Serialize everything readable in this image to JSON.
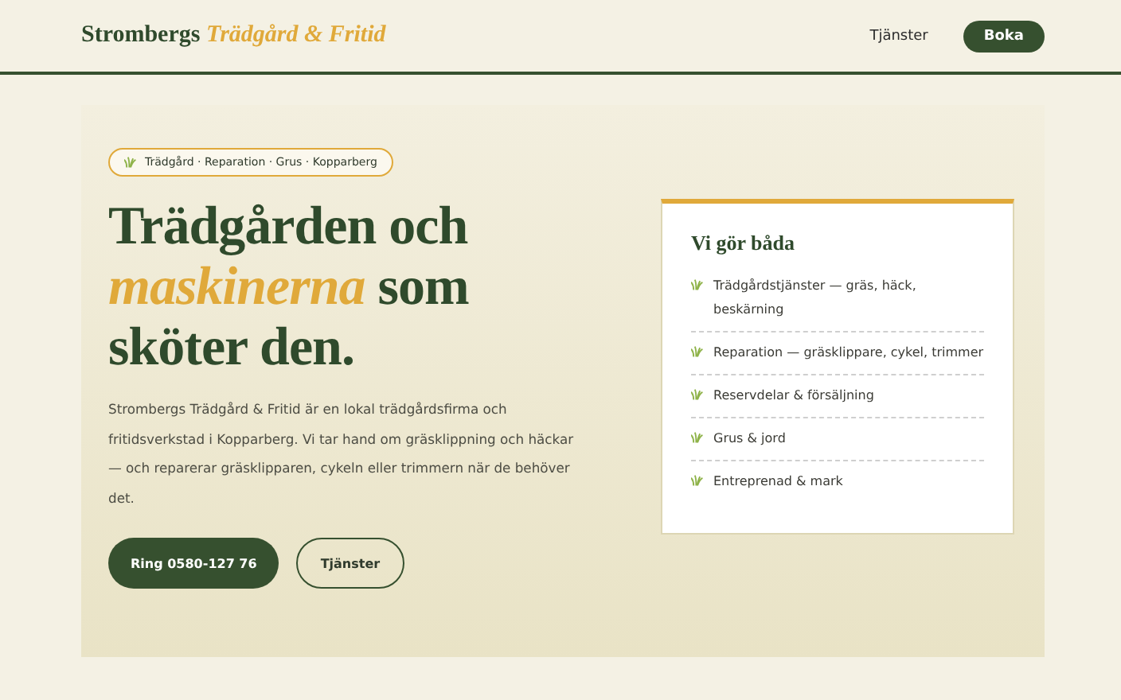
{
  "header": {
    "logo": "Strombergs *Trädgård & Fritid*",
    "nav": [
      {
        "label": "Tjänster",
        "kind": "link"
      },
      {
        "label": "Boka",
        "kind": "button"
      }
    ]
  },
  "hero": {
    "badge": "Trädgård · Reparation · Grus · Kopparberg",
    "title": "Trädgården och *maskinerna* som sköter den.",
    "text": "Strombergs Trädgård & Fritid är en lokal trädgårdsfirma och fritidsverkstad i Kopparberg. Vi tar hand om gräsklippning och häckar — och reparerar gräsklipparen, cykeln eller trimmern när de behöver det.",
    "buttons": [
      {
        "label": "Ring 0580-127 76",
        "kind": "primary"
      },
      {
        "label": "Tjänster",
        "kind": "outline"
      }
    ]
  },
  "card": {
    "title": "Vi gör båda",
    "items": [
      "Trädgårdstjänster — gräs, häck, beskärning",
      "Reparation — gräsklippare, cykel, trimmer",
      "Reservdelar & försäljning",
      "Grus & jord",
      "Entreprenad & mark"
    ]
  }
}
